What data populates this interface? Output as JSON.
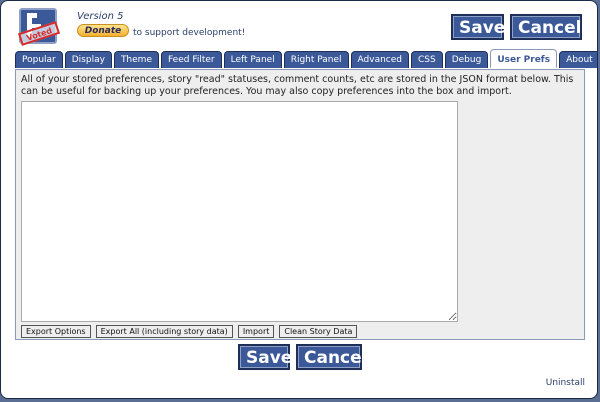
{
  "header": {
    "logo_stamp": "Voted",
    "version": "Version 5",
    "donate_label": "Donate",
    "support_text": "to support development!"
  },
  "actions": {
    "save_label": "Save",
    "cancel_label": "Cancel"
  },
  "tabs": [
    {
      "label": "Popular"
    },
    {
      "label": "Display"
    },
    {
      "label": "Theme"
    },
    {
      "label": "Feed Filter"
    },
    {
      "label": "Left Panel"
    },
    {
      "label": "Right Panel"
    },
    {
      "label": "Advanced"
    },
    {
      "label": "CSS"
    },
    {
      "label": "Debug"
    },
    {
      "label": "User Prefs",
      "active": true
    },
    {
      "label": "About"
    }
  ],
  "panel": {
    "description": "All of your stored preferences, story \"read\" statuses, comment counts, etc are stored in the JSON format below. This can be useful for backing up your preferences. You may also copy preferences into the box and import.",
    "json_value": "",
    "buttons": {
      "export_options": "Export Options",
      "export_all": "Export All (including story data)",
      "import": "Import",
      "clean": "Clean Story Data"
    }
  },
  "footer": {
    "uninstall_label": "Uninstall"
  }
}
